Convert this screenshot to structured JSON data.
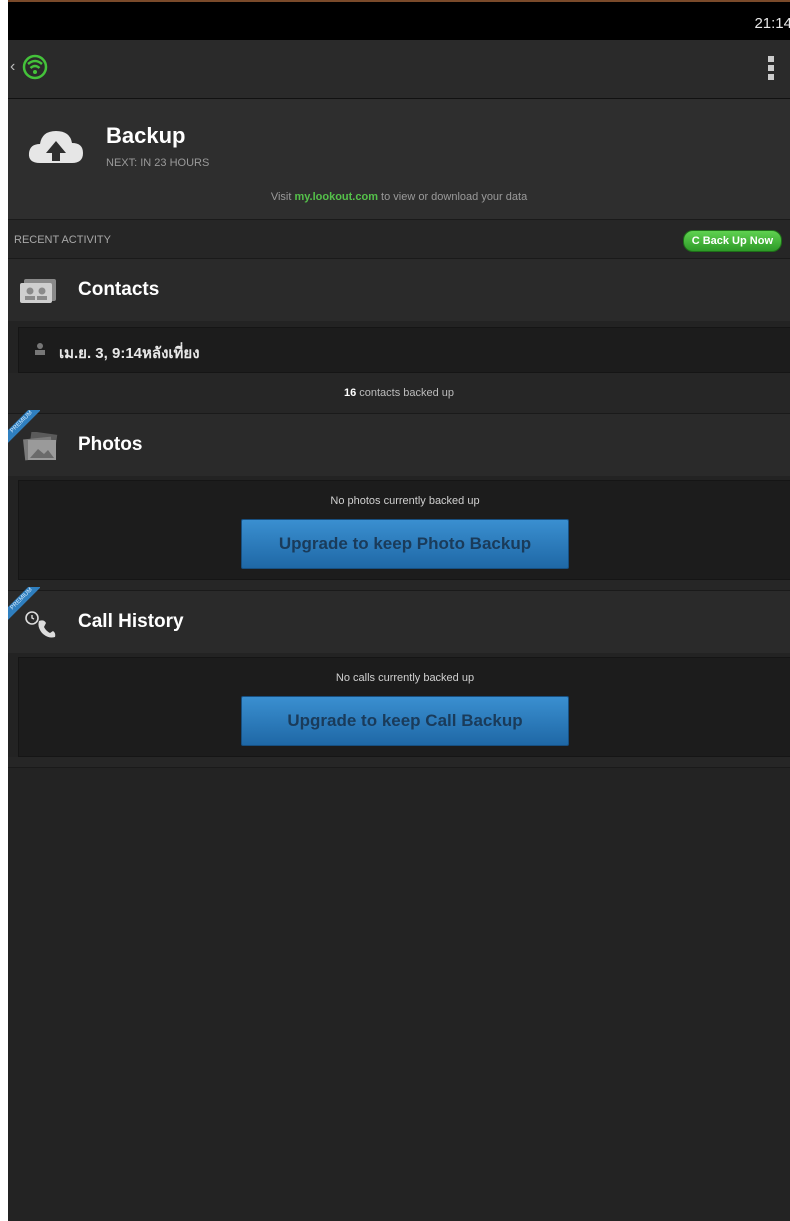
{
  "status_bar": {
    "time": "21:14"
  },
  "header": {
    "title": "Backup",
    "next": "NEXT: IN 23 HOURS",
    "visit_prefix": "Visit ",
    "visit_link": "my.lookout.com",
    "visit_suffix": " to view or download your data"
  },
  "recent": {
    "label": "RECENT ACTIVITY",
    "backup_now": "C Back Up Now"
  },
  "contacts": {
    "title": "Contacts",
    "date": "เม.ย. 3, 9:14หลังเที่ยง",
    "count": "16",
    "count_suffix": " contacts backed up"
  },
  "photos": {
    "title": "Photos",
    "message": "No photos currently backed up",
    "upgrade": "Upgrade to keep Photo Backup"
  },
  "calls": {
    "title": "Call History",
    "message": "No calls currently backed up",
    "upgrade": "Upgrade to keep Call Backup"
  },
  "ribbon_label": "PREMIUM",
  "colors": {
    "accent_green": "#55c14a",
    "upgrade_blue": "#2f7fbf"
  }
}
